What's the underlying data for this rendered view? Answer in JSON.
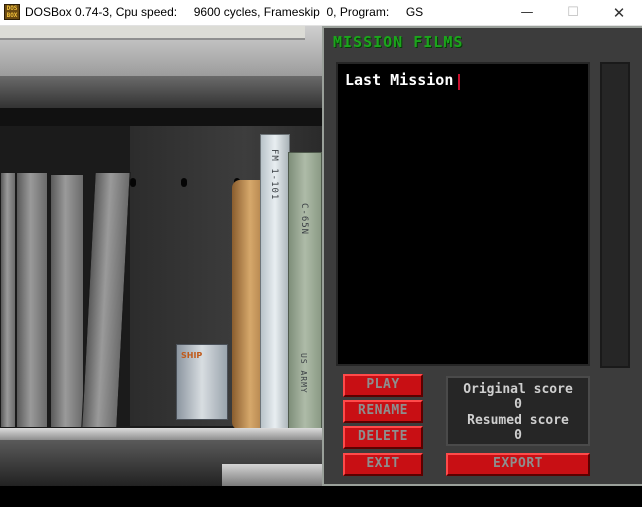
{
  "window": {
    "title": "DOSBox 0.74-3, Cpu speed:     9600 cycles, Frameskip  0, Program:     GS",
    "icon_text": "DOS BOX",
    "minimize_glyph": "—",
    "maximize_glyph": "☐",
    "close_glyph": "✕"
  },
  "scene": {
    "manual_spine": "FM 1-101",
    "manual_spine_2": "C-65N",
    "manual_spine_3": "US ARMY",
    "box_label": "SHIP"
  },
  "panel": {
    "title": "MISSION FILMS",
    "films": [
      "Last Mission"
    ],
    "buttons": {
      "play": "PLAY",
      "rename": "RENAME",
      "delete": "DELETE",
      "exit": "EXIT",
      "export": "EXPORT"
    },
    "scores": {
      "original_label": "Original score",
      "original_value": "0",
      "resumed_label": "Resumed score",
      "resumed_value": "0"
    }
  },
  "colors": {
    "title_green": "#1ca51c",
    "button_red": "#c80f14",
    "panel_gray": "#3c3c3c"
  }
}
